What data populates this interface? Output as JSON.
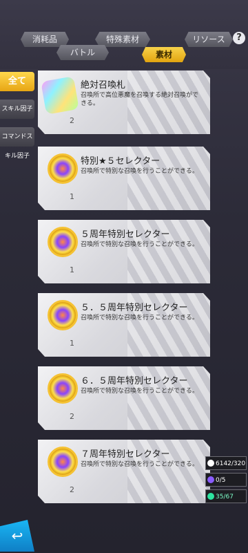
{
  "tabs": {
    "top": [
      {
        "label": "消耗品"
      },
      {
        "label": "特殊素材"
      },
      {
        "label": "リソース"
      }
    ],
    "bottom": [
      {
        "label": "バトル"
      },
      {
        "label": "素材",
        "active": true
      }
    ],
    "help_label": "?"
  },
  "side": [
    {
      "label": "全て",
      "active": true
    },
    {
      "label": "スキル因子"
    },
    {
      "label": "コマンドスキル因子"
    }
  ],
  "items": [
    {
      "name": "絶対召喚札",
      "count": "2",
      "desc": "召喚所で高位悪魔を召喚する絶対召喚ができる。",
      "icon": "summon-card-icon"
    },
    {
      "name": "特別★５セレクター",
      "count": "1",
      "desc": "召喚所で特別な召喚を行うことができる。",
      "icon": "selector-icon"
    },
    {
      "name": "５周年特別セレクター",
      "count": "1",
      "desc": "召喚所で特別な召喚を行うことができる。",
      "icon": "selector-icon"
    },
    {
      "name": "５．５周年特別セレクター",
      "count": "1",
      "desc": "召喚所で特別な召喚を行うことができる。",
      "icon": "selector-icon"
    },
    {
      "name": "６．５周年特別セレクター",
      "count": "2",
      "desc": "召喚所で特別な召喚を行うことができる。",
      "icon": "selector-icon"
    },
    {
      "name": "７周年特別セレクター",
      "count": "2",
      "desc": "召喚所で特別な召喚を行うことができる。",
      "icon": "selector-icon"
    }
  ],
  "stats": [
    {
      "value": "6142/320",
      "icon": "runner-icon"
    },
    {
      "value": "0/5",
      "icon": "demon-icon"
    },
    {
      "value": "35/67",
      "icon": "energy-icon"
    }
  ],
  "back_label": "↩"
}
